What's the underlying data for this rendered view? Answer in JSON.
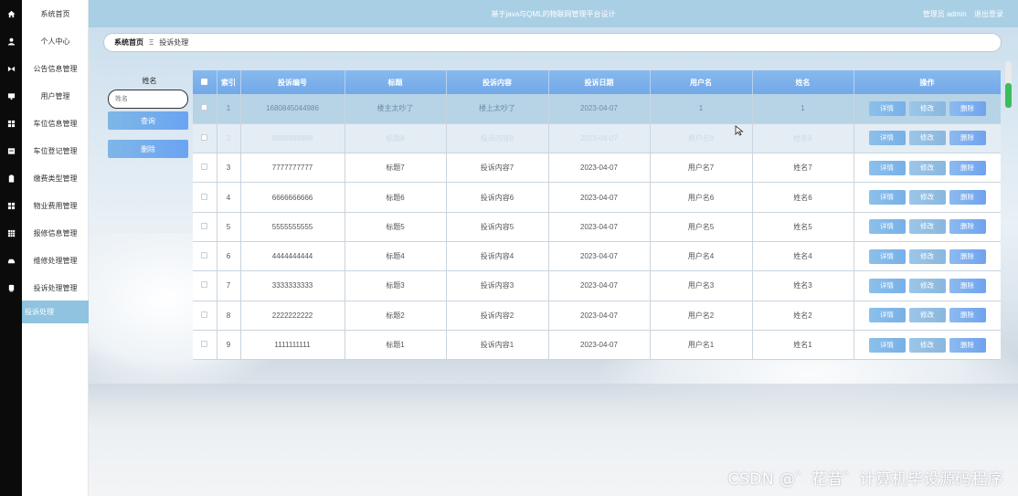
{
  "topbar": {
    "title": "基于java与QML的物联网管理平台设计",
    "role": "管理员 admin",
    "logout": "退出登录"
  },
  "breadcrumb": {
    "home": "系统首页",
    "separator": "Ξ",
    "current": "投诉处理"
  },
  "sidebar": {
    "items": [
      {
        "label": "系统首页",
        "icon": "home-icon"
      },
      {
        "label": "个人中心",
        "icon": "user-icon"
      },
      {
        "label": "公告信息管理",
        "icon": "notice-icon"
      },
      {
        "label": "用户管理",
        "icon": "monitor-icon"
      },
      {
        "label": "车位信息管理",
        "icon": "grid-icon"
      },
      {
        "label": "车位登记管理",
        "icon": "register-icon"
      },
      {
        "label": "缴费类型管理",
        "icon": "clipboard-icon"
      },
      {
        "label": "物业费用管理",
        "icon": "grid-icon"
      },
      {
        "label": "报修信息管理",
        "icon": "table-icon"
      },
      {
        "label": "维修处理管理",
        "icon": "car-icon"
      },
      {
        "label": "投诉处理管理",
        "icon": "phone-icon"
      }
    ],
    "active_sub": "投诉处理"
  },
  "search": {
    "label": "姓名",
    "placeholder": "姓名",
    "query_button": "查询",
    "delete_button": "删除"
  },
  "table": {
    "columns": [
      "索引",
      "投诉编号",
      "标题",
      "投诉内容",
      "投诉日期",
      "用户名",
      "姓名",
      "操作"
    ],
    "rows": [
      {
        "index": "1",
        "code": "1680845044986",
        "title": "楼主太吵了",
        "content": "楼上太吵了",
        "date": "2023-04-07",
        "username": "1",
        "name": "1"
      },
      {
        "index": "2",
        "code": "8888888888",
        "title": "标题8",
        "content": "投诉内容8",
        "date": "2023-04-07",
        "username": "用户名8",
        "name": "姓名8"
      },
      {
        "index": "3",
        "code": "7777777777",
        "title": "标题7",
        "content": "投诉内容7",
        "date": "2023-04-07",
        "username": "用户名7",
        "name": "姓名7"
      },
      {
        "index": "4",
        "code": "6666666666",
        "title": "标题6",
        "content": "投诉内容6",
        "date": "2023-04-07",
        "username": "用户名6",
        "name": "姓名6"
      },
      {
        "index": "5",
        "code": "5555555555",
        "title": "标题5",
        "content": "投诉内容5",
        "date": "2023-04-07",
        "username": "用户名5",
        "name": "姓名5"
      },
      {
        "index": "6",
        "code": "4444444444",
        "title": "标题4",
        "content": "投诉内容4",
        "date": "2023-04-07",
        "username": "用户名4",
        "name": "姓名4"
      },
      {
        "index": "7",
        "code": "3333333333",
        "title": "标题3",
        "content": "投诉内容3",
        "date": "2023-04-07",
        "username": "用户名3",
        "name": "姓名3"
      },
      {
        "index": "8",
        "code": "2222222222",
        "title": "标题2",
        "content": "投诉内容2",
        "date": "2023-04-07",
        "username": "用户名2",
        "name": "姓名2"
      },
      {
        "index": "9",
        "code": "1111111111",
        "title": "标题1",
        "content": "投诉内容1",
        "date": "2023-04-07",
        "username": "用户名1",
        "name": "姓名1"
      }
    ],
    "actions": {
      "detail": "详情",
      "edit": "修改",
      "delete": "删除"
    }
  },
  "watermark": "CSDN @゛花昔゛计算机毕设源码程序",
  "colors": {
    "topbar": "#a9cfe5",
    "header": "#7eb2ec",
    "button": "#7fb6e6",
    "active_menu": "#8fc3e0"
  }
}
